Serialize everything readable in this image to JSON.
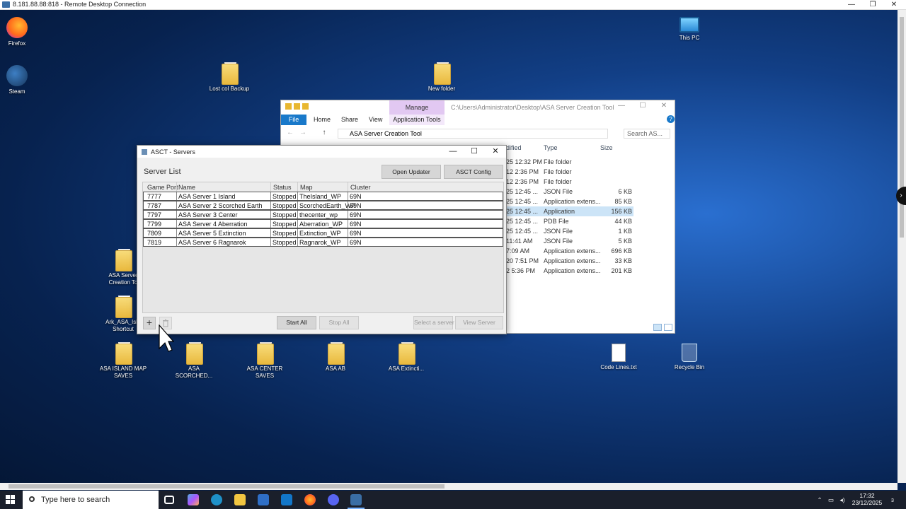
{
  "rdp": {
    "title": "8.181.88.88:818 - Remote Desktop Connection",
    "min": "—",
    "max": "❐",
    "close": "✕"
  },
  "desktop_icons": {
    "firefox": "Firefox",
    "steam": "Steam",
    "lost_backup": "Lost col Backup",
    "new_folder": "New folder",
    "this_pc": "This PC",
    "asa_creation_tool": "ASA Server Creation To",
    "ark_shortcut": "Ark_ASA_Isl - Shortcut",
    "asa_island": "ASA ISLAND MAP SAVES",
    "asa_scorched": "ASA SCORCHED...",
    "asa_center": "ASA CENTER SAVES",
    "asa_ab": "ASA AB",
    "asa_extinct": "ASA Extincti...",
    "code_lines": "Code Lines.txt",
    "recycle_bin": "Recycle Bin"
  },
  "explorer": {
    "manage_tab": "Manage",
    "path_title": "C:\\Users\\Administrator\\Desktop\\ASA Server Creation Tool",
    "file_tab": "File",
    "tabs": [
      "Home",
      "Share",
      "View"
    ],
    "app_tools_tab": "Application Tools",
    "address": "ASA Server Creation Tool",
    "search_placeholder": "Search AS...",
    "columns": {
      "modified": "dified",
      "type": "Type",
      "size": "Size"
    },
    "rows": [
      {
        "modified": "25 12:32 PM",
        "type": "File folder",
        "size": ""
      },
      {
        "modified": "12 2:36 PM",
        "type": "File folder",
        "size": ""
      },
      {
        "modified": "12 2:36 PM",
        "type": "File folder",
        "size": ""
      },
      {
        "modified": "25 12:45 ...",
        "type": "JSON File",
        "size": "6 KB"
      },
      {
        "modified": "25 12:45 ...",
        "type": "Application extens...",
        "size": "85 KB"
      },
      {
        "modified": "25 12:45 ...",
        "type": "Application",
        "size": "156 KB"
      },
      {
        "modified": "25 12:45 ...",
        "type": "PDB File",
        "size": "44 KB"
      },
      {
        "modified": "25 12:45 ...",
        "type": "JSON File",
        "size": "1 KB"
      },
      {
        "modified": "11:41 AM",
        "type": "JSON File",
        "size": "5 KB"
      },
      {
        "modified": "7:09 AM",
        "type": "Application extens...",
        "size": "696 KB"
      },
      {
        "modified": "20 7:51 PM",
        "type": "Application extens...",
        "size": "33 KB"
      },
      {
        "modified": "2 5:36 PM",
        "type": "Application extens...",
        "size": "201 KB"
      }
    ]
  },
  "asct": {
    "title": "ASCT - Servers",
    "min": "—",
    "max": "☐",
    "close": "✕",
    "heading": "Server List",
    "open_updater": "Open Updater",
    "asct_config": "ASCT Config",
    "columns": {
      "port": "Game Port",
      "name": "Name",
      "status": "Status",
      "map": "Map",
      "cluster": "Cluster"
    },
    "servers": [
      {
        "port": "7777",
        "name": "ASA Server 1 Island",
        "status": "Stopped",
        "map": "TheIsland_WP",
        "cluster": "69N"
      },
      {
        "port": "7787",
        "name": "ASA Server 2 Scorched Earth",
        "status": "Stopped",
        "map": "ScorchedEarth_WP",
        "cluster": "69N"
      },
      {
        "port": "7797",
        "name": "ASA Server 3 Center",
        "status": "Stopped",
        "map": "thecenter_wp",
        "cluster": "69N"
      },
      {
        "port": "7799",
        "name": "ASA Server 4 Aberration",
        "status": "Stopped",
        "map": "Aberration_WP",
        "cluster": "69N"
      },
      {
        "port": "7809",
        "name": "ASA Server 5 Extinction",
        "status": "Stopped",
        "map": "Extinction_WP",
        "cluster": "69N"
      },
      {
        "port": "7819",
        "name": "ASA Server 6 Ragnarok",
        "status": "Stopped",
        "map": "Ragnarok_WP",
        "cluster": "69N"
      }
    ],
    "add": "+",
    "start_all": "Start All",
    "stop_all": "Stop All",
    "select_server": "Select a server",
    "view_server": "View Server"
  },
  "taskbar": {
    "search_placeholder": "Type here to search",
    "time": "17:32",
    "date": "23/12/2025",
    "notifications": "3"
  }
}
